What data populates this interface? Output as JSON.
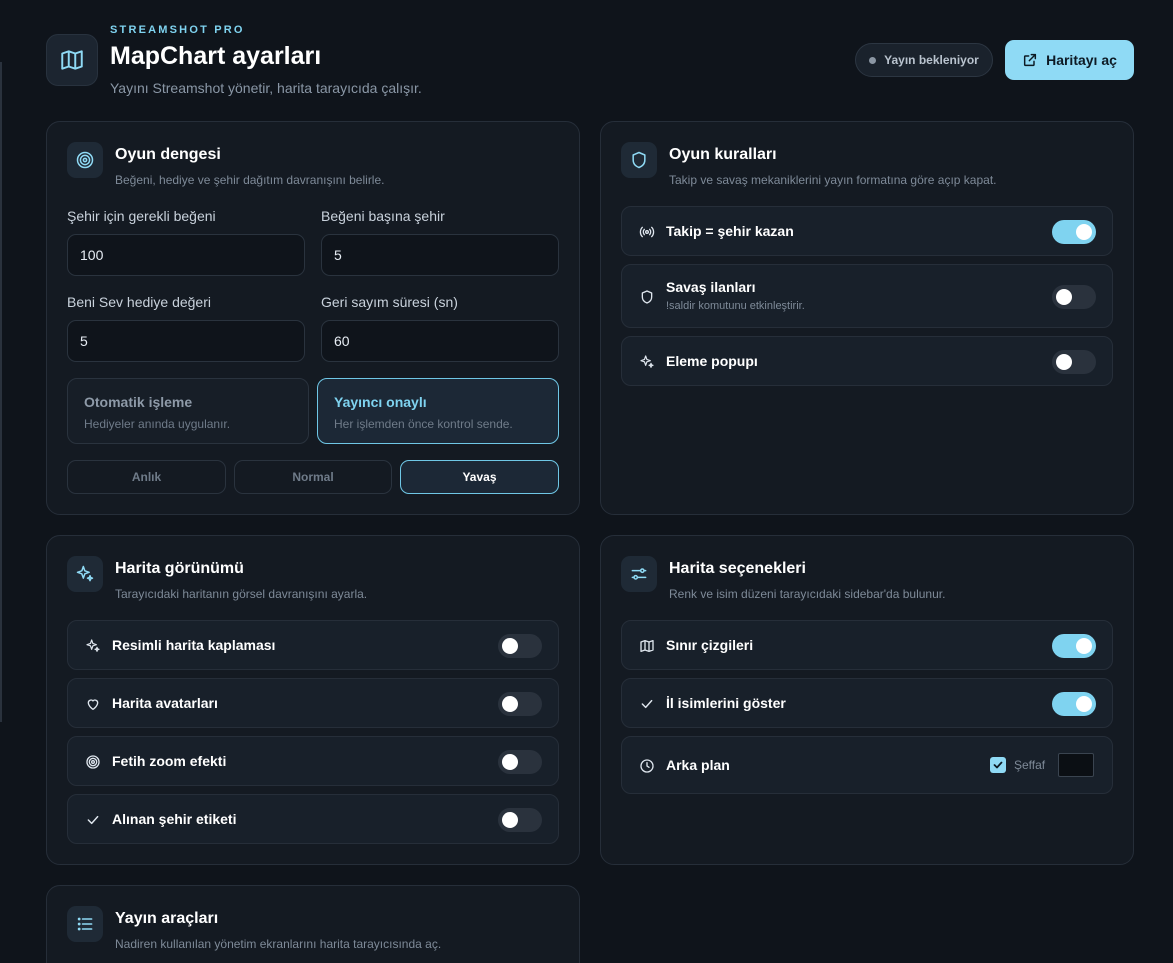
{
  "header": {
    "eyebrow": "STREAMSHOT PRO",
    "title": "MapChart ayarları",
    "subtitle": "Yayını Streamshot yönetir, harita tarayıcıda çalışır.",
    "status": "Yayın bekleniyor",
    "open_map_button": "Haritayı aç"
  },
  "game_balance": {
    "title": "Oyun dengesi",
    "desc": "Beğeni, hediye ve şehir dağıtım davranışını belirle.",
    "fields": [
      {
        "label": "Şehir için gerekli beğeni",
        "value": "100"
      },
      {
        "label": "Beğeni başına şehir",
        "value": "5"
      },
      {
        "label": "Beni Sev hediye değeri",
        "value": "5"
      },
      {
        "label": "Geri sayım süresi (sn)",
        "value": "60"
      }
    ],
    "modes": [
      {
        "title": "Otomatik işleme",
        "desc": "Hediyeler anında uygulanır.",
        "active": false
      },
      {
        "title": "Yayıncı onaylı",
        "desc": "Her işlemden önce kontrol sende.",
        "active": true
      }
    ],
    "speeds": [
      {
        "label": "Anlık",
        "active": false
      },
      {
        "label": "Normal",
        "active": false
      },
      {
        "label": "Yavaş",
        "active": true
      }
    ]
  },
  "game_rules": {
    "title": "Oyun kuralları",
    "desc": "Takip ve savaş mekaniklerini yayın formatına göre açıp kapat.",
    "items": [
      {
        "label": "Takip = şehir kazan",
        "sub": "",
        "on": true,
        "icon": "broadcast-icon"
      },
      {
        "label": "Savaş ilanları",
        "sub": "!saldir komutunu etkinleştirir.",
        "on": false,
        "icon": "shield-icon"
      },
      {
        "label": "Eleme popupı",
        "sub": "",
        "on": false,
        "icon": "sparkles-icon"
      }
    ]
  },
  "map_view": {
    "title": "Harita görünümü",
    "desc": "Tarayıcıdaki haritanın görsel davranışını ayarla.",
    "items": [
      {
        "label": "Resimli harita kaplaması",
        "on": false,
        "icon": "sparkles-icon"
      },
      {
        "label": "Harita avatarları",
        "on": false,
        "icon": "heart-icon"
      },
      {
        "label": "Fetih zoom efekti",
        "on": false,
        "icon": "target-icon"
      },
      {
        "label": "Alınan şehir etiketi",
        "on": false,
        "icon": "check-icon"
      }
    ]
  },
  "map_options": {
    "title": "Harita seçenekleri",
    "desc": "Renk ve isim düzeni tarayıcıdaki sidebar'da bulunur.",
    "items": [
      {
        "label": "Sınır çizgileri",
        "on": true,
        "icon": "map-icon"
      },
      {
        "label": "İl isimlerini göster",
        "on": true,
        "icon": "check-icon"
      }
    ],
    "background": {
      "label": "Arka plan",
      "transparent_label": "Şeffaf",
      "transparent": true,
      "color": "#0b0f14"
    }
  },
  "stream_tools": {
    "title": "Yayın araçları",
    "desc": "Nadiren kullanılan yönetim ekranlarını harita tarayıcısında aç."
  },
  "colors": {
    "accent": "#7fd3f0",
    "background": "#0f141b",
    "card": "#141a22"
  }
}
